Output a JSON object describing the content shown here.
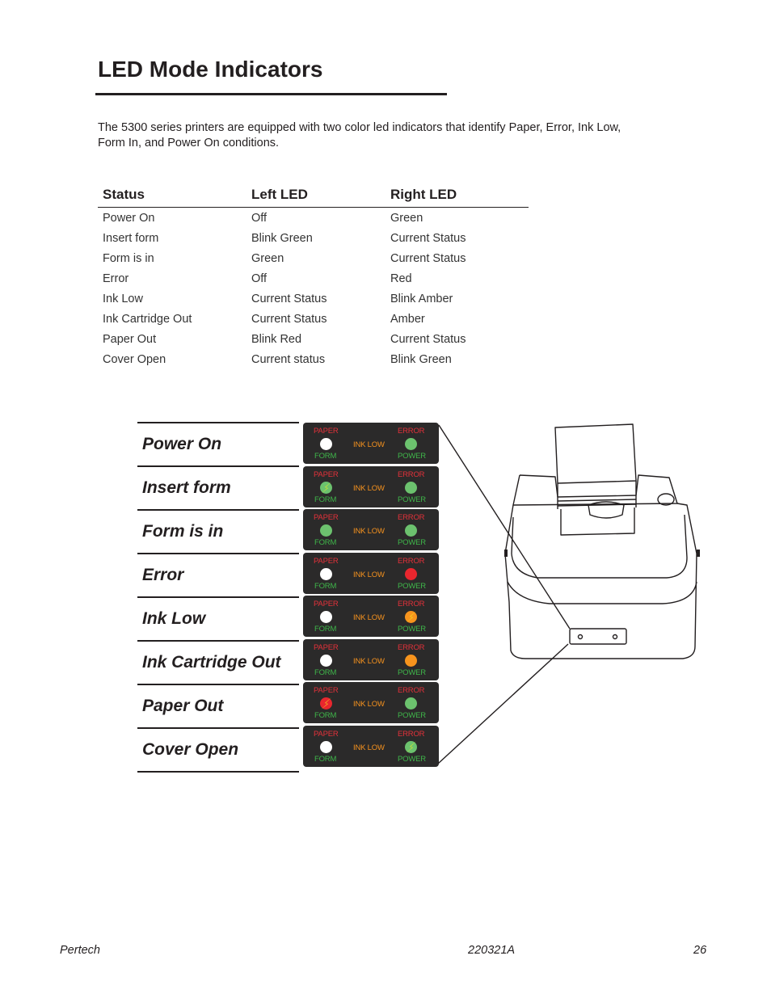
{
  "page": {
    "title": "LED Mode Indicators",
    "intro": "The 5300 series printers are equipped with two color led indicators that identify Paper, Error, Ink Low, Form In, and Power On conditions."
  },
  "table": {
    "headers": [
      "Status",
      "Left LED",
      "Right LED"
    ],
    "rows": [
      [
        "Power On",
        "Off",
        "Green"
      ],
      [
        "Insert form",
        "Blink Green",
        "Current Status"
      ],
      [
        "Form is in",
        "Green",
        "Current Status"
      ],
      [
        "Error",
        "Off",
        "Red"
      ],
      [
        "Ink Low",
        "Current Status",
        "Blink Amber"
      ],
      [
        "Ink Cartridge Out",
        "Current Status",
        "Amber"
      ],
      [
        "Paper Out",
        "Blink Red",
        "Current Status"
      ],
      [
        "Cover Open",
        "Current status",
        "Blink Green"
      ]
    ]
  },
  "panel_text": {
    "paper": "PAPER",
    "form": "FORM",
    "ink_low": "INK LOW",
    "error": "ERROR",
    "power": "POWER"
  },
  "colors": {
    "panel_bg": "#2b2a2a",
    "off": "#ffffff",
    "green": "#6cc26e",
    "red": "#e9262e",
    "amber": "#f7941d",
    "blink_flash": "#f5ec1b"
  },
  "diagram": [
    {
      "label": "Power On",
      "left": {
        "color": "off",
        "blink": false
      },
      "right": {
        "color": "green",
        "blink": false
      }
    },
    {
      "label": "Insert form",
      "left": {
        "color": "green",
        "blink": true
      },
      "right": {
        "color": "green",
        "blink": false
      }
    },
    {
      "label": "Form is in",
      "left": {
        "color": "green",
        "blink": false
      },
      "right": {
        "color": "green",
        "blink": false
      }
    },
    {
      "label": "Error",
      "left": {
        "color": "off",
        "blink": false
      },
      "right": {
        "color": "red",
        "blink": false
      }
    },
    {
      "label": "Ink Low",
      "left": {
        "color": "off",
        "blink": false
      },
      "right": {
        "color": "amber",
        "blink": true
      }
    },
    {
      "label": "Ink Cartridge Out",
      "left": {
        "color": "off",
        "blink": false
      },
      "right": {
        "color": "amber",
        "blink": false
      }
    },
    {
      "label": "Paper Out",
      "left": {
        "color": "red",
        "blink": true
      },
      "right": {
        "color": "green",
        "blink": false
      }
    },
    {
      "label": "Cover Open",
      "left": {
        "color": "off",
        "blink": false
      },
      "right": {
        "color": "green",
        "blink": true
      }
    }
  ],
  "footer": {
    "left": "Pertech",
    "center": "220321A",
    "page_number": "26"
  }
}
